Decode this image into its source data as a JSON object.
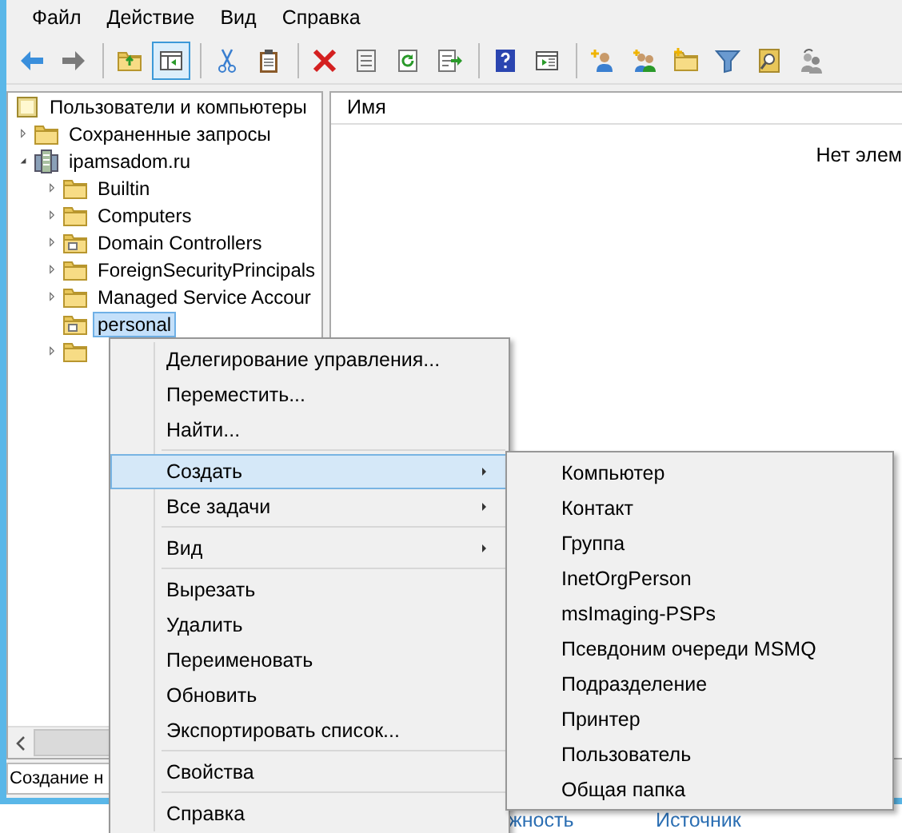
{
  "menubar": [
    "Файл",
    "Действие",
    "Вид",
    "Справка"
  ],
  "toolbar": [
    {
      "pressed": false
    },
    {
      "pressed": false
    },
    {
      "pressed": false
    },
    {
      "pressed": true
    },
    {
      "pressed": false
    },
    {
      "pressed": false
    },
    {
      "pressed": false
    },
    {
      "pressed": false
    },
    {
      "pressed": false
    },
    {
      "pressed": false
    },
    {
      "pressed": false
    },
    {
      "pressed": false
    },
    {
      "pressed": false
    },
    {
      "pressed": false
    },
    {
      "pressed": false
    },
    {
      "pressed": false
    },
    {
      "pressed": false
    },
    {
      "pressed": false
    }
  ],
  "tree": [
    {
      "label": "Пользователи и компьютеры",
      "kind": "root",
      "selected": false,
      "children": [
        {
          "label": "Сохраненные запросы",
          "kind": "folder",
          "expanded": false,
          "selected": false
        },
        {
          "label": "ipamsadom.ru",
          "kind": "domain",
          "expanded": true,
          "selected": false,
          "children": [
            {
              "label": "Builtin",
              "kind": "folder",
              "expanded": false,
              "selected": false
            },
            {
              "label": "Computers",
              "kind": "folder",
              "expanded": false,
              "selected": false
            },
            {
              "label": "Domain Controllers",
              "kind": "ou",
              "expanded": false,
              "selected": false
            },
            {
              "label": "ForeignSecurityPrincipals",
              "kind": "folder",
              "expanded": false,
              "selected": false
            },
            {
              "label": "Managed Service Accour",
              "kind": "folder",
              "expanded": false,
              "selected": false
            },
            {
              "label": "personal",
              "kind": "ou",
              "selected": true
            },
            {
              "kind": "folder",
              "expanded": false
            }
          ]
        }
      ]
    }
  ],
  "list": {
    "columns": [
      "Имя"
    ],
    "empty_message": "Нет элем"
  },
  "status_bar": "Создание н",
  "footer_links": [
    "жность",
    "Источник"
  ],
  "context_menu": [
    [
      {
        "label": "Делегирование управления...",
        "submenu": false,
        "selected": false
      },
      {
        "label": "Переместить...",
        "submenu": false,
        "selected": false
      },
      {
        "label": "Найти...",
        "submenu": false,
        "selected": false
      }
    ],
    [
      {
        "label": "Создать",
        "submenu": true,
        "selected": true
      },
      {
        "label": "Все задачи",
        "submenu": true,
        "selected": false
      }
    ],
    [
      {
        "label": "Вид",
        "submenu": true,
        "selected": false
      }
    ],
    [
      {
        "label": "Вырезать",
        "submenu": false,
        "selected": false
      },
      {
        "label": "Удалить",
        "submenu": false,
        "selected": false
      },
      {
        "label": "Переименовать",
        "submenu": false,
        "selected": false
      },
      {
        "label": "Обновить",
        "submenu": false,
        "selected": false
      },
      {
        "label": "Экспортировать список...",
        "submenu": false,
        "selected": false
      }
    ],
    [
      {
        "label": "Свойства",
        "submenu": false,
        "selected": false
      }
    ],
    [
      {
        "label": "Справка",
        "submenu": false,
        "selected": false
      }
    ]
  ],
  "submenu": [
    "Компьютер",
    "Контакт",
    "Группа",
    "InetOrgPerson",
    "msImaging-PSPs",
    "Псевдоним очереди MSMQ",
    "Подразделение",
    "Принтер",
    "Пользователь",
    "Общая папка"
  ]
}
